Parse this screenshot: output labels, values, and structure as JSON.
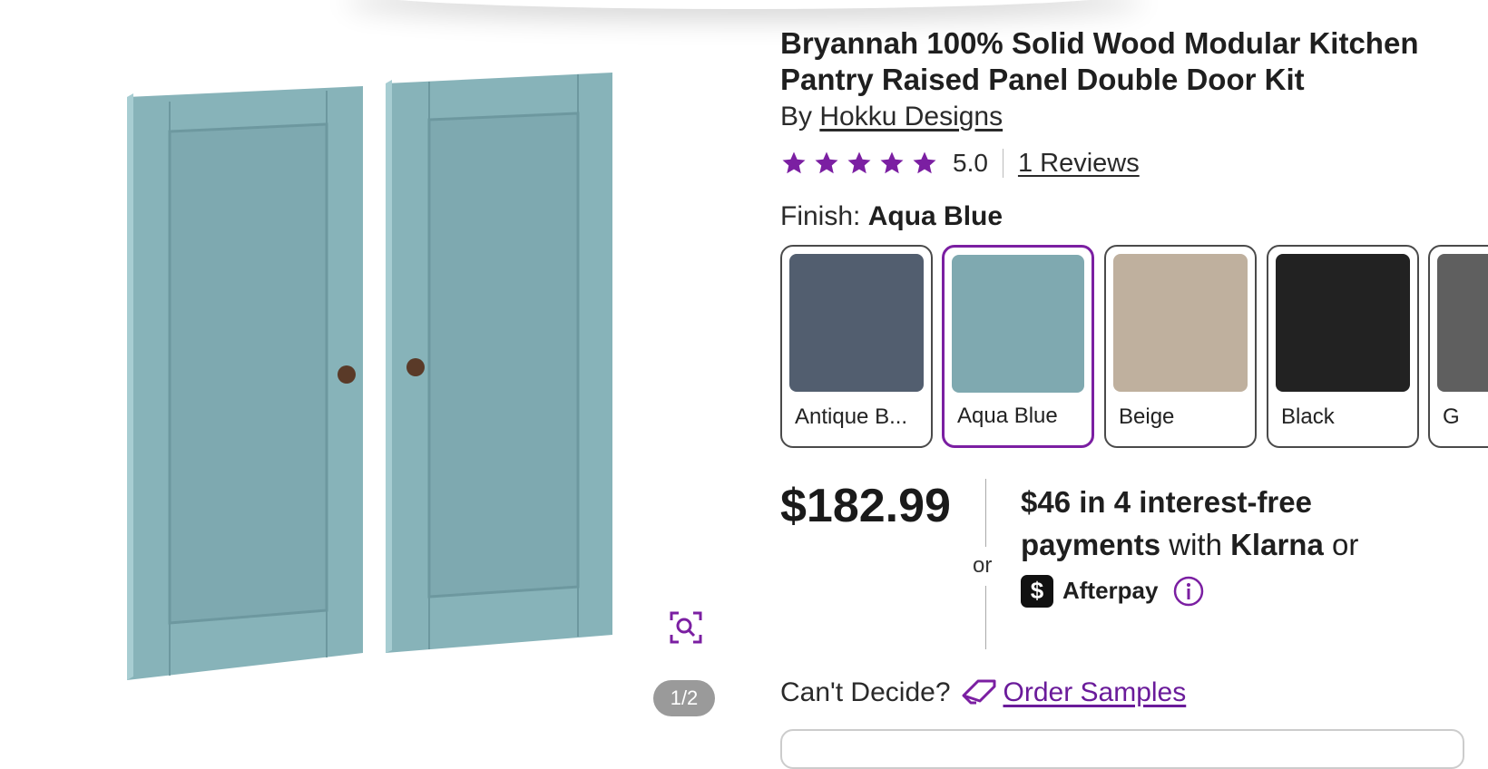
{
  "product": {
    "title_line1": "Bryannah 100% Solid Wood Modular Kitchen",
    "title_line2": "Pantry Raised Panel Double Door Kit",
    "by_prefix": "By",
    "brand": "Hokku Designs",
    "rating_value": "5.0",
    "rating_stars": 5,
    "reviews_link": "1 Reviews"
  },
  "finish": {
    "label": "Finish:",
    "selected": "Aqua Blue",
    "options": [
      {
        "label": "Antique B...",
        "color": "#525e6f"
      },
      {
        "label": "Aqua Blue",
        "color": "#7fa9b0"
      },
      {
        "label": "Beige",
        "color": "#bfb09e"
      },
      {
        "label": "Black",
        "color": "#222222"
      },
      {
        "label": "G",
        "color": "#5f5f5f"
      }
    ]
  },
  "pricing": {
    "price": "$182.99",
    "or": "or",
    "installment_amount": "$46",
    "installment_text": " in 4 interest-free",
    "payments_word": "payments",
    "with_text": " with ",
    "klarna": "Klarna",
    "or_text": " or",
    "afterpay_symbol": "$",
    "afterpay": "Afterpay"
  },
  "samples": {
    "prompt": "Can't Decide?",
    "link": "Order Samples"
  },
  "gallery": {
    "pager": "1/2"
  },
  "colors": {
    "accent": "#7b1fa2",
    "door": "#80aab2",
    "knob": "#5a3a28"
  },
  "icons": [
    "zoom-icon",
    "star-icon",
    "info-icon",
    "tag-icon",
    "afterpay-icon"
  ]
}
